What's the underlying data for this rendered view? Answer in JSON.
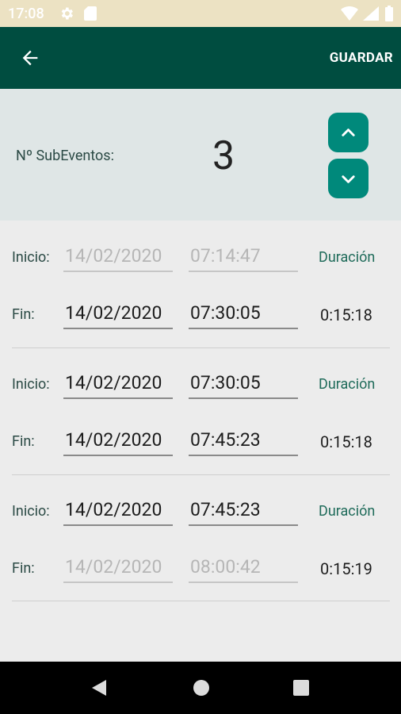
{
  "status_bar": {
    "time": "17:08"
  },
  "toolbar": {
    "save_label": "GUARDAR"
  },
  "subeventos": {
    "label": "Nº SubEventos:",
    "count": "3"
  },
  "labels": {
    "inicio": "Inicio:",
    "fin": "Fin:",
    "duracion": "Duración"
  },
  "subevents": [
    {
      "inicio_date": "14/02/2020",
      "inicio_time": "07:14:47",
      "fin_date": "14/02/2020",
      "fin_time": "07:30:05",
      "duration": "0:15:18"
    },
    {
      "inicio_date": "14/02/2020",
      "inicio_time": "07:30:05",
      "fin_date": "14/02/2020",
      "fin_time": "07:45:23",
      "duration": "0:15:18"
    },
    {
      "inicio_date": "14/02/2020",
      "inicio_time": "07:45:23",
      "fin_date": "14/02/2020",
      "fin_time": "08:00:42",
      "duration": "0:15:19"
    }
  ],
  "colors": {
    "toolbar": "#004d40",
    "accent": "#00897b",
    "status_bar": "#ece2c3"
  },
  "icons": [
    "gear-icon",
    "sd-card-icon",
    "wifi-icon",
    "cell-signal-icon",
    "battery-icon",
    "back-arrow-icon",
    "chevron-up-icon",
    "chevron-down-icon",
    "nav-back-icon",
    "nav-home-icon",
    "nav-recents-icon"
  ]
}
